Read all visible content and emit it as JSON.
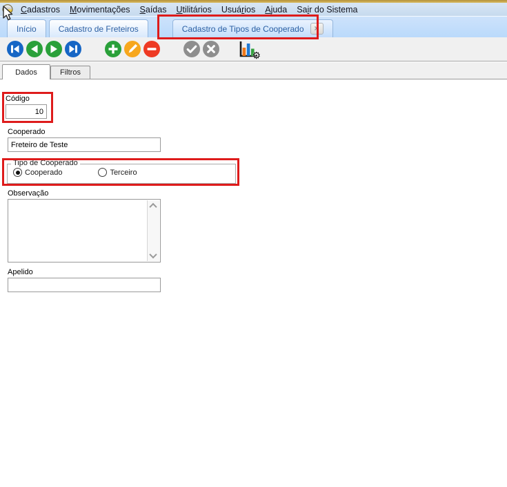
{
  "colors": {
    "highlight_red": "#DE1B1B",
    "nav_blue": "#1666C5",
    "nav_green": "#2AA03A",
    "add_green": "#2AA03A",
    "edit_orange": "#F7A71D",
    "delete_red": "#EE3A24",
    "confirm_gray": "#8E8E8E",
    "cancel_gray": "#8E8E8E",
    "chart_orange": "#F07818",
    "chart_blue": "#1F7AD4",
    "chart_green": "#33A03C",
    "tab_text_blue": "#2B5FA3"
  },
  "glyphs": {
    "close_x": "×",
    "gear": "⚙"
  },
  "menu": {
    "items": [
      {
        "pre": "",
        "accel": "C",
        "post": "adastros"
      },
      {
        "pre": "",
        "accel": "M",
        "post": "ovimentações"
      },
      {
        "pre": "",
        "accel": "S",
        "post": "aídas"
      },
      {
        "pre": "",
        "accel": "U",
        "post": "tilitários"
      },
      {
        "pre": "Usuá",
        "accel": "r",
        "post": "ios"
      },
      {
        "pre": "",
        "accel": "A",
        "post": "juda"
      },
      {
        "pre": "Sa",
        "accel": "i",
        "post": "r do Sistema"
      }
    ]
  },
  "tabs": {
    "items": [
      {
        "label": "Início"
      },
      {
        "label": "Cadastro de Freteiros"
      },
      {
        "label": "Cadastro de Tipos de Cooperado",
        "closable": true
      }
    ]
  },
  "toolbar": {
    "icons": [
      "first-record",
      "previous-record",
      "next-record",
      "last-record",
      "add-record",
      "edit-record",
      "delete-record",
      "confirm",
      "cancel",
      "chart-settings"
    ]
  },
  "subtabs": {
    "items": [
      {
        "label": "Dados",
        "active": true
      },
      {
        "label": "Filtros",
        "active": false
      }
    ]
  },
  "form": {
    "codigo": {
      "label": "Código",
      "value": "10"
    },
    "cooperado": {
      "label": "Cooperado",
      "value": "Freteiro de Teste"
    },
    "tipo": {
      "legend": "Tipo de Cooperado",
      "options": [
        {
          "label": "Cooperado",
          "selected": true
        },
        {
          "label": "Terceiro",
          "selected": false
        }
      ]
    },
    "observacao": {
      "label": "Observação",
      "value": ""
    },
    "apelido": {
      "label": "Apelido",
      "value": ""
    }
  }
}
